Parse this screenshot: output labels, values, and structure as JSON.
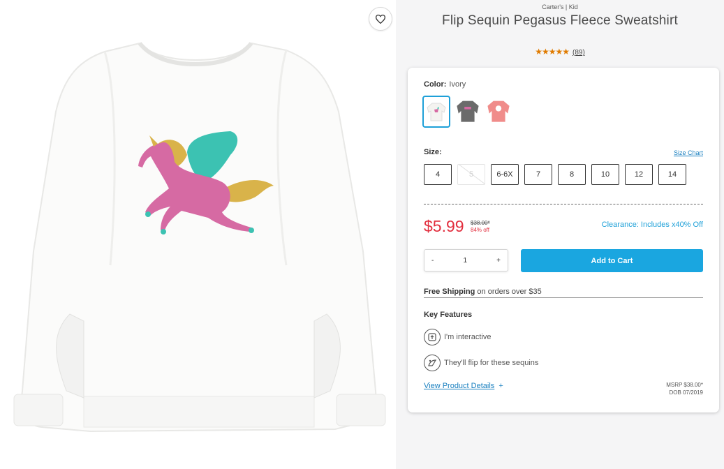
{
  "product": {
    "brand_line": "Carter's | Kid",
    "title": "Flip Sequin Pegasus Fleece Sweatshirt",
    "stars": "★★★★★",
    "review_count": "(89)"
  },
  "color": {
    "label": "Color:",
    "value": "Ivory",
    "swatches": [
      {
        "name": "Ivory",
        "hex": "#f4f3f0",
        "selected": true
      },
      {
        "name": "Heather Gray",
        "hex": "#6b6b6b",
        "selected": false
      },
      {
        "name": "Pink",
        "hex": "#f08c8a",
        "selected": false
      }
    ]
  },
  "size": {
    "label": "Size:",
    "chart_link": "Size Chart",
    "options": [
      "4",
      "5",
      "6-6X",
      "7",
      "8",
      "10",
      "12",
      "14"
    ],
    "unavailable": [
      "5"
    ]
  },
  "pricing": {
    "sale_price": "$5.99",
    "original_price": "$38.00*",
    "discount": "84% off",
    "clearance_note": "Clearance: Includes x40% Off"
  },
  "quantity": {
    "minus": "-",
    "value": "1",
    "plus": "+"
  },
  "cart": {
    "button_label": "Add to Cart"
  },
  "shipping": {
    "bold": "Free Shipping",
    "rest": "on orders over $35"
  },
  "features": {
    "title": "Key Features",
    "items": [
      {
        "text": "I'm interactive",
        "icon": "interactive-icon"
      },
      {
        "text": "They'll flip for these sequins",
        "icon": "sequin-icon"
      }
    ]
  },
  "details": {
    "link": "View Product Details",
    "plus": "+",
    "msrp": "MSRP $38.00*",
    "dob": "DOB 07/2019"
  },
  "colors": {
    "accent": "#1aa6e0",
    "sale_red": "#e22e3e",
    "star_orange": "#e07b00",
    "link_blue": "#1a80c0"
  }
}
